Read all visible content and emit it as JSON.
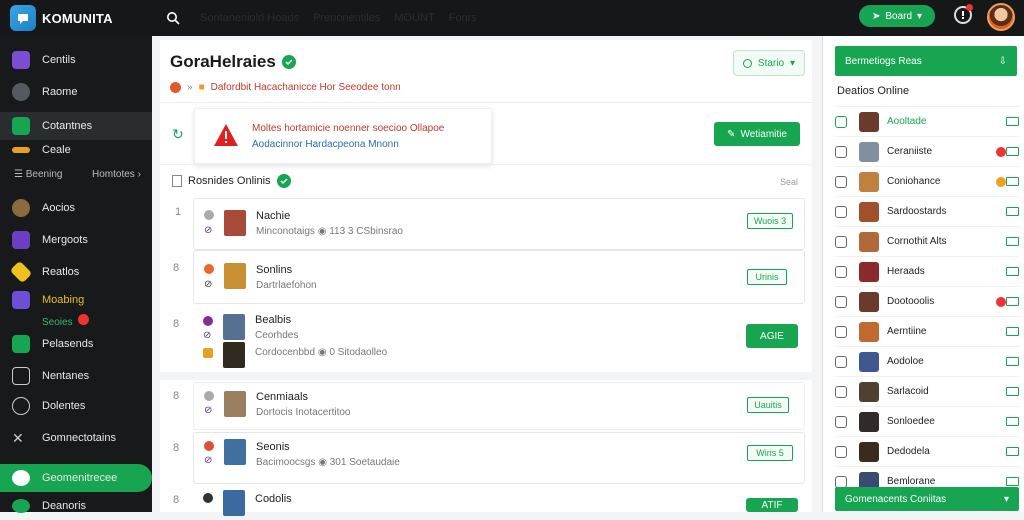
{
  "app": {
    "name": "KOMUNITA",
    "top_tabs": [
      "Sontaneniold Hoads",
      "Prenonentiles",
      "MOUNT",
      "Fonrs"
    ],
    "top_button": "Board"
  },
  "sidebar": {
    "items": [
      {
        "label": "Centils",
        "color": "#7b4dd1"
      },
      {
        "label": "Raome",
        "color": "#555a60"
      },
      {
        "label": "Cotantnes",
        "color": "#17a552"
      },
      {
        "label": "Ceale",
        "color": "#e8a020"
      },
      {
        "label": "Aocios",
        "color": "#8a6a3a"
      },
      {
        "label": "Mergoots",
        "color": "#6b3fc4"
      },
      {
        "label": "Reatlos",
        "color": "#f0c020"
      },
      {
        "label": "Moabing",
        "color": "#6b4fd6"
      },
      {
        "label": "Pelasends",
        "color": "#17a552"
      },
      {
        "label": "Nentanes",
        "color": "#3a3d40"
      },
      {
        "label": "Dolentes",
        "color": "#3a3d40"
      },
      {
        "label": "Gomnectotains",
        "color": "#3a3d40"
      },
      {
        "label": "Geomenitrecee",
        "color": "#ffffff"
      },
      {
        "label": "Deanoris",
        "color": "#3a3d40"
      }
    ],
    "sub_bearing": "Beening",
    "sub_homtors": "Homtotes",
    "sub_seoies": "Seoies"
  },
  "main": {
    "title": "GoraHelraies",
    "status_button": "Stario",
    "sub_line": "Dafordbit Hacachanicce Hor Seeodee tonn",
    "alert_line_1": "Moltes hortamicie noenner soecioo Ollapoe",
    "alert_line_2": "Aodacinnor Hardacpeona Mnonn",
    "action_button": "Wetiamitie",
    "section_title": "Rosnides Onlinis",
    "section_more": "Seal",
    "rows": [
      {
        "num": "1",
        "name": "Nachie",
        "meta": "Minconotaigs  ◉  113  3  CSbinsrao",
        "button": "Wuois 3",
        "av": "#a84a3a"
      },
      {
        "num": "8",
        "name": "Sonlins",
        "meta": "Dartrlaefohon",
        "button": "Urinis",
        "av": "#c89030"
      },
      {
        "num": "8",
        "name": "Bealbis",
        "meta": "Cordocenbbd  ◉  0  Sitodaolleo",
        "button": "AGIE",
        "sub_name": "Ceorhdes",
        "av": "#557090",
        "av2": "#302a20"
      },
      {
        "num": "8",
        "name": "Cenmiaals",
        "meta": "Dortocis Inotacertitoo",
        "button": "Uauitis",
        "av": "#9a8060"
      },
      {
        "num": "8",
        "name": "Seonis",
        "meta": "Bacimoocsgs  ◉  301  Soetaudaie",
        "button": "Wiris 5",
        "av": "#4070a0"
      },
      {
        "num": "8",
        "name": "Codolis",
        "meta": "",
        "button": "ATIF",
        "av": "#3a6aa0"
      }
    ]
  },
  "right_panel": {
    "header": "Bermetiogs Reas",
    "title": "Deatios Online",
    "items": [
      {
        "name": "Aooltade",
        "green": true,
        "badge": "",
        "av": "#6a3a2a"
      },
      {
        "name": "Ceraniiste",
        "green": false,
        "badge": "#e33",
        "av": "#8090a0"
      },
      {
        "name": "Coniohance",
        "green": false,
        "badge": "#f0a020",
        "av": "#c08040"
      },
      {
        "name": "Sardoostards",
        "green": false,
        "badge": "",
        "av": "#a0502a"
      },
      {
        "name": "Cornothit Alts",
        "green": false,
        "badge": "",
        "av": "#b06a3a"
      },
      {
        "name": "Heraads",
        "green": false,
        "badge": "",
        "av": "#8a2a2a"
      },
      {
        "name": "Dootooolis",
        "green": false,
        "badge": "#e33",
        "av": "#6a3a2a"
      },
      {
        "name": "Aerntiine",
        "green": false,
        "badge": "",
        "av": "#c06a30"
      },
      {
        "name": "Aodoloe",
        "green": false,
        "badge": "",
        "av": "#405890"
      },
      {
        "name": "Sarlacoid",
        "green": false,
        "badge": "",
        "av": "#504030"
      },
      {
        "name": "Sonloedee",
        "green": false,
        "badge": "",
        "av": "#302a28"
      },
      {
        "name": "Dedodela",
        "green": false,
        "badge": "",
        "av": "#3a2a20"
      },
      {
        "name": "Bemlorane",
        "green": false,
        "badge": "",
        "av": "#3a4a70"
      }
    ],
    "footer": "Gomenacents Coniitas"
  }
}
